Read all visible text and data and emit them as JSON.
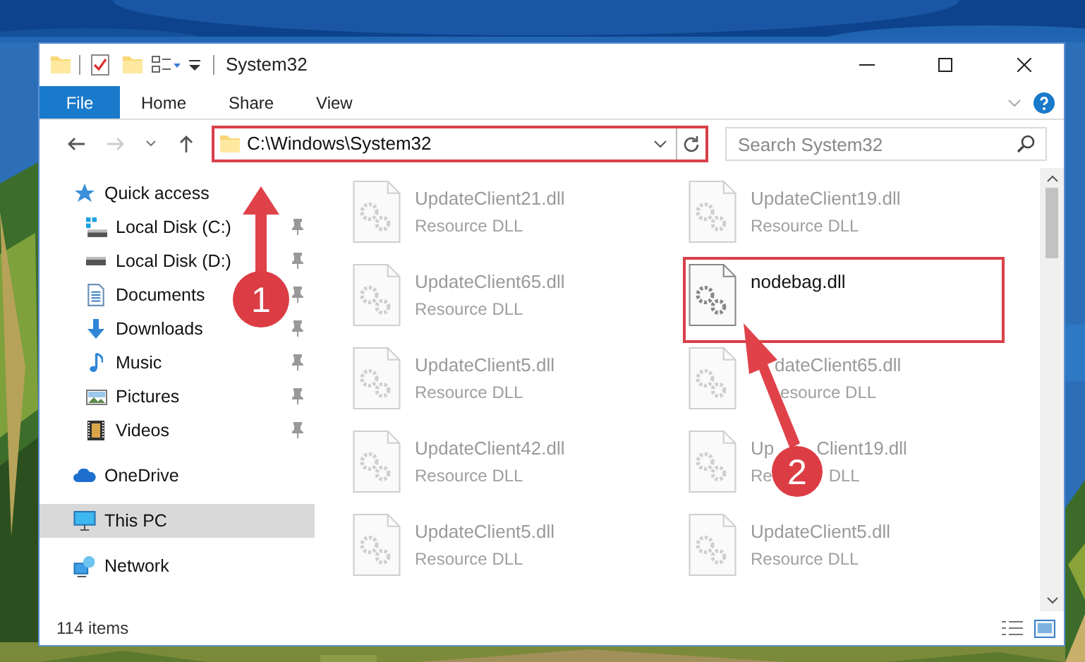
{
  "window": {
    "title": "System32"
  },
  "ribbon_tabs": [
    {
      "label": "File",
      "selected": true
    },
    {
      "label": "Home",
      "selected": false
    },
    {
      "label": "Share",
      "selected": false
    },
    {
      "label": "View",
      "selected": false
    }
  ],
  "address_bar": {
    "path": "C:\\Windows\\System32",
    "highlighted": true
  },
  "search": {
    "placeholder": "Search System32"
  },
  "navigation": [
    {
      "label": "Quick access",
      "selected": false,
      "children": [
        {
          "label": "Local Disk (C:)",
          "pinned": true,
          "selected": false
        },
        {
          "label": "Local Disk (D:)",
          "pinned": true,
          "selected": false
        },
        {
          "label": "Documents",
          "pinned": true,
          "selected": false
        },
        {
          "label": "Downloads",
          "pinned": true,
          "selected": false
        },
        {
          "label": "Music",
          "pinned": true,
          "selected": false
        },
        {
          "label": "Pictures",
          "pinned": true,
          "selected": false
        },
        {
          "label": "Videos",
          "pinned": true,
          "selected": false
        }
      ]
    },
    {
      "label": "OneDrive",
      "selected": false
    },
    {
      "label": "This PC",
      "selected": true
    },
    {
      "label": "Network",
      "selected": false
    }
  ],
  "files": [
    {
      "name": "UpdateClient21.dll",
      "type": "Resource DLL",
      "dimmed": true,
      "highlighted": false
    },
    {
      "name": "UpdateClient19.dll",
      "type": "Resource DLL",
      "dimmed": true,
      "highlighted": false
    },
    {
      "name": "UpdateClient65.dll",
      "type": "Resource DLL",
      "dimmed": true,
      "highlighted": false
    },
    {
      "name": "nodebag.dll",
      "dimmed": false,
      "highlighted": true
    },
    {
      "name": "UpdateClient5.dll",
      "type": "Resource DLL",
      "dimmed": true,
      "highlighted": false
    },
    {
      "name": "dateClient65.dll",
      "type": "esource DLL",
      "dimmed": true,
      "highlighted": false
    },
    {
      "name": "UpdateClient42.dll",
      "type": "Resource DLL",
      "dimmed": true,
      "highlighted": false
    },
    {
      "name": "Up",
      "name_end": "Client19.dll",
      "type": "Re",
      "type_end": "DLL",
      "dimmed": true,
      "highlighted": false
    },
    {
      "name": "UpdateClient5.dll",
      "type": "Resource DLL",
      "dimmed": true,
      "highlighted": false
    },
    {
      "name": "UpdateClient5.dll",
      "type": "Resource DLL",
      "dimmed": true,
      "highlighted": false
    }
  ],
  "status_bar": {
    "item_count": "114 items"
  },
  "callouts": [
    {
      "label": "1"
    },
    {
      "label": "2"
    }
  ]
}
